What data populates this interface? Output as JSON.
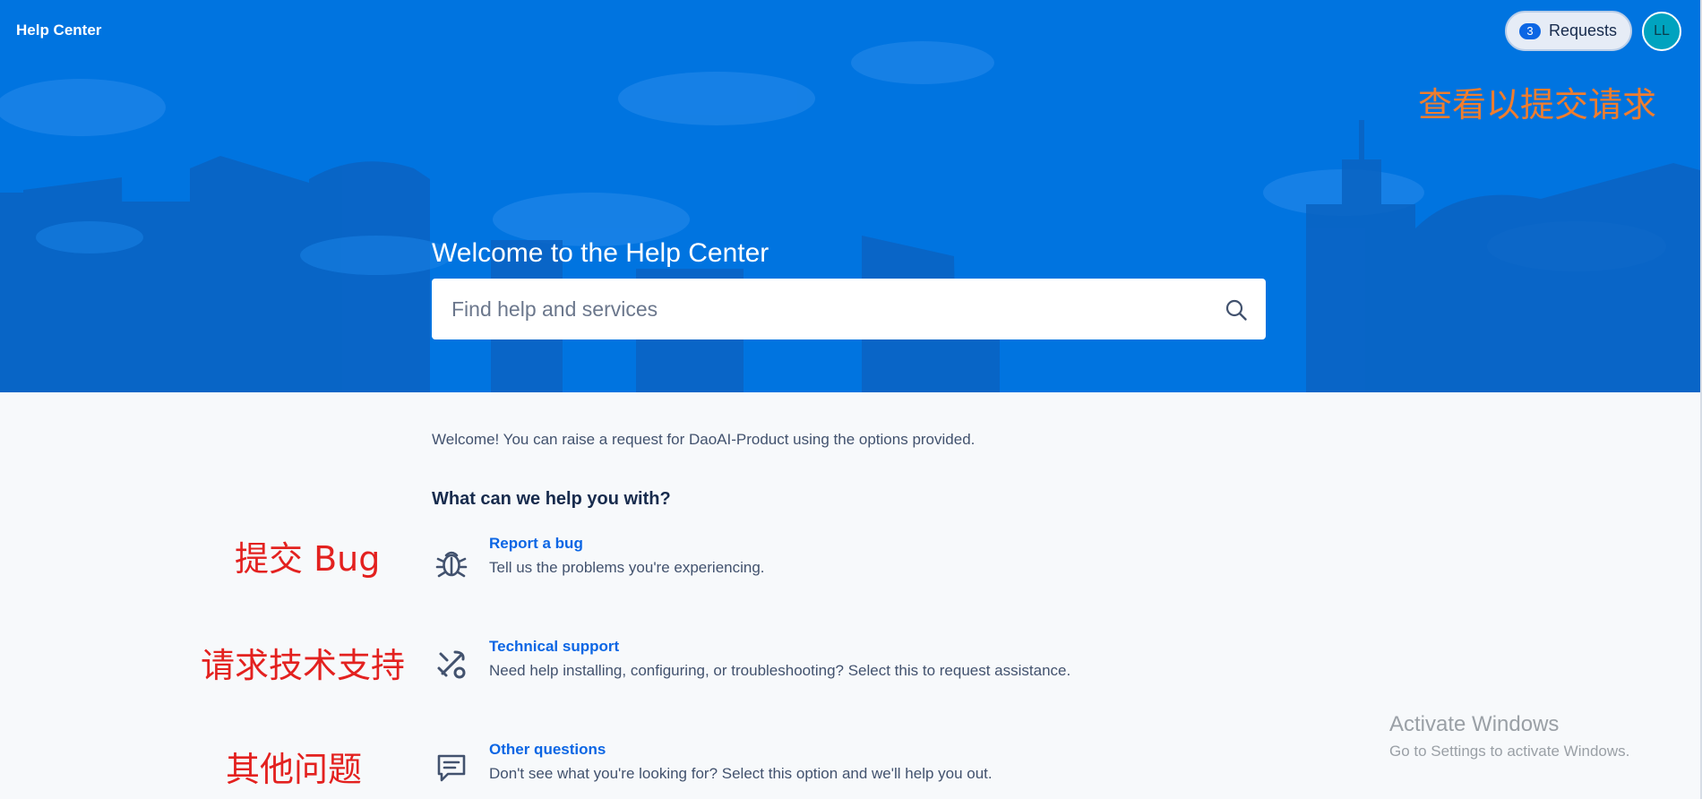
{
  "header": {
    "brand": "Help Center",
    "requests": {
      "count": "3",
      "label": "Requests"
    },
    "avatar_initials": "LL"
  },
  "hero": {
    "title": "Welcome to the Help Center",
    "search_placeholder": "Find help and services",
    "search_icon": "search-icon"
  },
  "main": {
    "welcome_text": "Welcome! You can raise a request for DaoAI-Product using the options provided.",
    "heading": "What can we help you with?",
    "options": [
      {
        "icon": "bug-icon",
        "name": "Report a bug",
        "description": "Tell us the problems you're experiencing."
      },
      {
        "icon": "tools-icon",
        "name": "Technical support",
        "description": "Need help installing, configuring, or troubleshooting? Select this to request assistance."
      },
      {
        "icon": "comment-icon",
        "name": "Other questions",
        "description": "Don't see what you're looking for? Select this option and we'll help you out."
      }
    ]
  },
  "annotations": {
    "requests_note": "查看以提交请求",
    "bug_note": "提交 Bug",
    "support_note": "请求技术支持",
    "other_note": "其他问题"
  },
  "watermark": {
    "line1": "Activate Windows",
    "line2": "Go to Settings to activate Windows."
  },
  "colors": {
    "hero": "#0074e0",
    "link": "#0c66e4",
    "annotation_orange": "#ef7d2e",
    "annotation_red": "#e3211f"
  }
}
